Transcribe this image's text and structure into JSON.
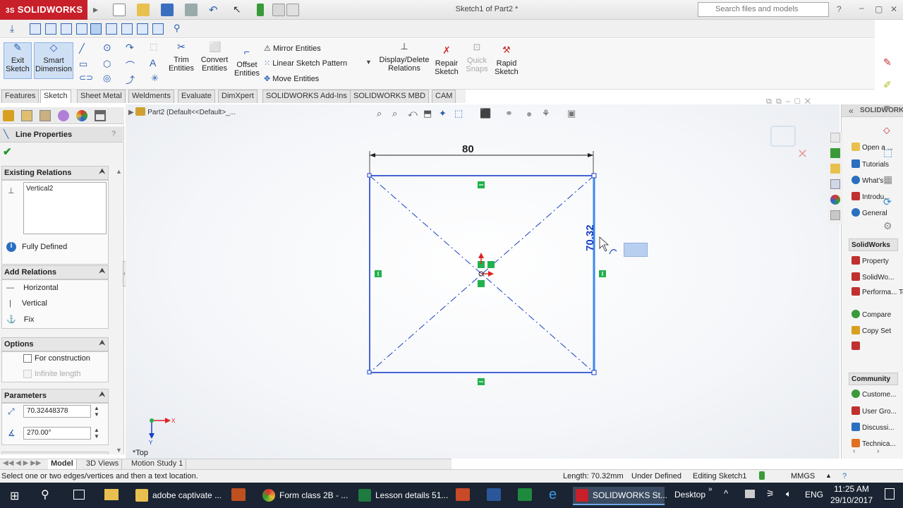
{
  "app": {
    "brand": "SOLIDWORKS",
    "brand_prefix": "3S",
    "doc_title": "Sketch1 of Part2 *"
  },
  "search": {
    "placeholder": "Search files and models"
  },
  "command_manager": {
    "exit_sketch": "Exit Sketch",
    "smart_dimension": "Smart Dimension",
    "trim_entities": "Trim Entities",
    "convert_entities": "Convert Entities",
    "offset_entities": "Offset Entities",
    "mirror_entities": "Mirror Entities",
    "linear_pattern": "Linear Sketch Pattern",
    "move_entities": "Move Entities",
    "display_delete": "Display/Delete Relations",
    "repair_sketch": "Repair Sketch",
    "quick_snaps": "Quick Snaps",
    "rapid_sketch": "Rapid Sketch"
  },
  "tabs": [
    "Features",
    "Sketch",
    "Sheet Metal",
    "Weldments",
    "Evaluate",
    "DimXpert",
    "SOLIDWORKS Add-Ins",
    "SOLIDWORKS MBD",
    "CAM"
  ],
  "active_tab": "Sketch",
  "tree": {
    "root": "Part2  (Default<<Default>_..."
  },
  "property_manager": {
    "title": "Line Properties",
    "help": "?",
    "existing_relations": {
      "header": "Existing Relations",
      "items": [
        "Vertical2"
      ],
      "status": "Fully Defined"
    },
    "add_relations": {
      "header": "Add Relations",
      "items": [
        "Horizontal",
        "Vertical",
        "Fix"
      ]
    },
    "options": {
      "header": "Options",
      "for_construction": "For construction",
      "infinite_length": "Infinite length"
    },
    "parameters": {
      "header": "Parameters",
      "length": "70.32448378",
      "angle": "270.00°"
    }
  },
  "sketch": {
    "dim_horizontal": "80",
    "dim_vertical": "70.32",
    "view_label": "*Top",
    "axis_x": "X",
    "axis_y": "Y",
    "line_color": "#1a3fc8",
    "relation_color": "#22b14c"
  },
  "task_pane": {
    "section1_title": "SOLIDWORKS",
    "section1_items": [
      "Open a ...",
      "Tutorials",
      "What's ...",
      "Introdu...",
      "General"
    ],
    "section2_title": "SolidWorks",
    "section2_items": [
      "Property",
      "SolidWo...",
      "Performa... Test",
      "Compare",
      "Copy Set"
    ],
    "section3_title": "Community",
    "section3_items": [
      "Custome...",
      "User Gro...",
      "Discussi...",
      "Technica..."
    ]
  },
  "bottom_tabs": [
    "Model",
    "3D Views",
    "Motion Study 1"
  ],
  "status": {
    "message": "Select one or two edges/vertices and then a text location.",
    "length": "Length: 70.32mm",
    "definition": "Under Defined",
    "editing": "Editing Sketch1",
    "units": "MMGS"
  },
  "taskbar": {
    "apps": [
      "adobe captivate ...",
      "Form class 2B - ...",
      "Lesson details 51...",
      "SOLIDWORKS St..."
    ],
    "desktop": "Desktop",
    "lang": "ENG",
    "time": "11:25 AM",
    "date": "29/10/2017"
  }
}
